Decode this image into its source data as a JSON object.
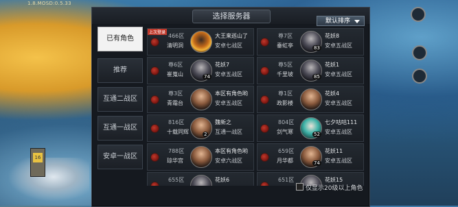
{
  "background": {
    "version_text": "1.8.MOSD:0.5.33"
  },
  "dialog": {
    "title": "选择服务器",
    "sort_label": "默认排序",
    "filter_label": "仅显示20级以上角色"
  },
  "tabs": [
    {
      "label": "已有角色",
      "active": true
    },
    {
      "label": "推荐",
      "active": false
    },
    {
      "label": "互通二战区",
      "active": false
    },
    {
      "label": "互通一战区",
      "active": false
    },
    {
      "label": "安卓一战区",
      "active": false
    }
  ],
  "servers": [
    {
      "zone": "466区",
      "name": "清明洞",
      "role_name": "大王来巡山了",
      "role_server": "安卓七战区",
      "level": "",
      "tag": "上次登录",
      "avatar": "fire"
    },
    {
      "zone": "尊7区",
      "name": "垂虹亭",
      "role_name": "花妖8",
      "role_server": "安卓五战区",
      "level": "83",
      "tag": "",
      "avatar": "dark"
    },
    {
      "zone": "尊6区",
      "name": "崔嵬山",
      "role_name": "花妖7",
      "role_server": "安卓五战区",
      "level": "74",
      "tag": "",
      "avatar": "dark"
    },
    {
      "zone": "尊5区",
      "name": "千里坡",
      "role_name": "花妖1",
      "role_server": "安卓五战区",
      "level": "85",
      "tag": "",
      "avatar": "dark"
    },
    {
      "zone": "尊3区",
      "name": "青霜台",
      "role_name": "本区有角色哟",
      "role_server": "安卓五战区",
      "level": "",
      "tag": "",
      "avatar": "skin"
    },
    {
      "zone": "尊1区",
      "name": "政影楼",
      "role_name": "花妖4",
      "role_server": "安卓五战区",
      "level": "",
      "tag": "",
      "avatar": "skin"
    },
    {
      "zone": "816区",
      "name": "十载同辉",
      "role_name": "魏新之",
      "role_server": "互通一战区",
      "level": "2",
      "tag": "",
      "avatar": "skin"
    },
    {
      "zone": "804区",
      "name": "剑气寒",
      "role_name": "七夕咕咕111",
      "role_server": "安卓五战区",
      "level": "52",
      "tag": "",
      "avatar": "teal"
    },
    {
      "zone": "788区",
      "name": "琼华宫",
      "role_name": "本区有角色哟",
      "role_server": "安卓六战区",
      "level": "",
      "tag": "",
      "avatar": "skin"
    },
    {
      "zone": "659区",
      "name": "月华都",
      "role_name": "花妖11",
      "role_server": "安卓五战区",
      "level": "74",
      "tag": "",
      "avatar": "skin"
    },
    {
      "zone": "655区",
      "name": "",
      "role_name": "花妖6",
      "role_server": "",
      "level": "",
      "tag": "",
      "avatar": "dark"
    },
    {
      "zone": "651区",
      "name": "",
      "role_name": "花妖15",
      "role_server": "",
      "level": "",
      "tag": "",
      "avatar": "dark"
    }
  ]
}
